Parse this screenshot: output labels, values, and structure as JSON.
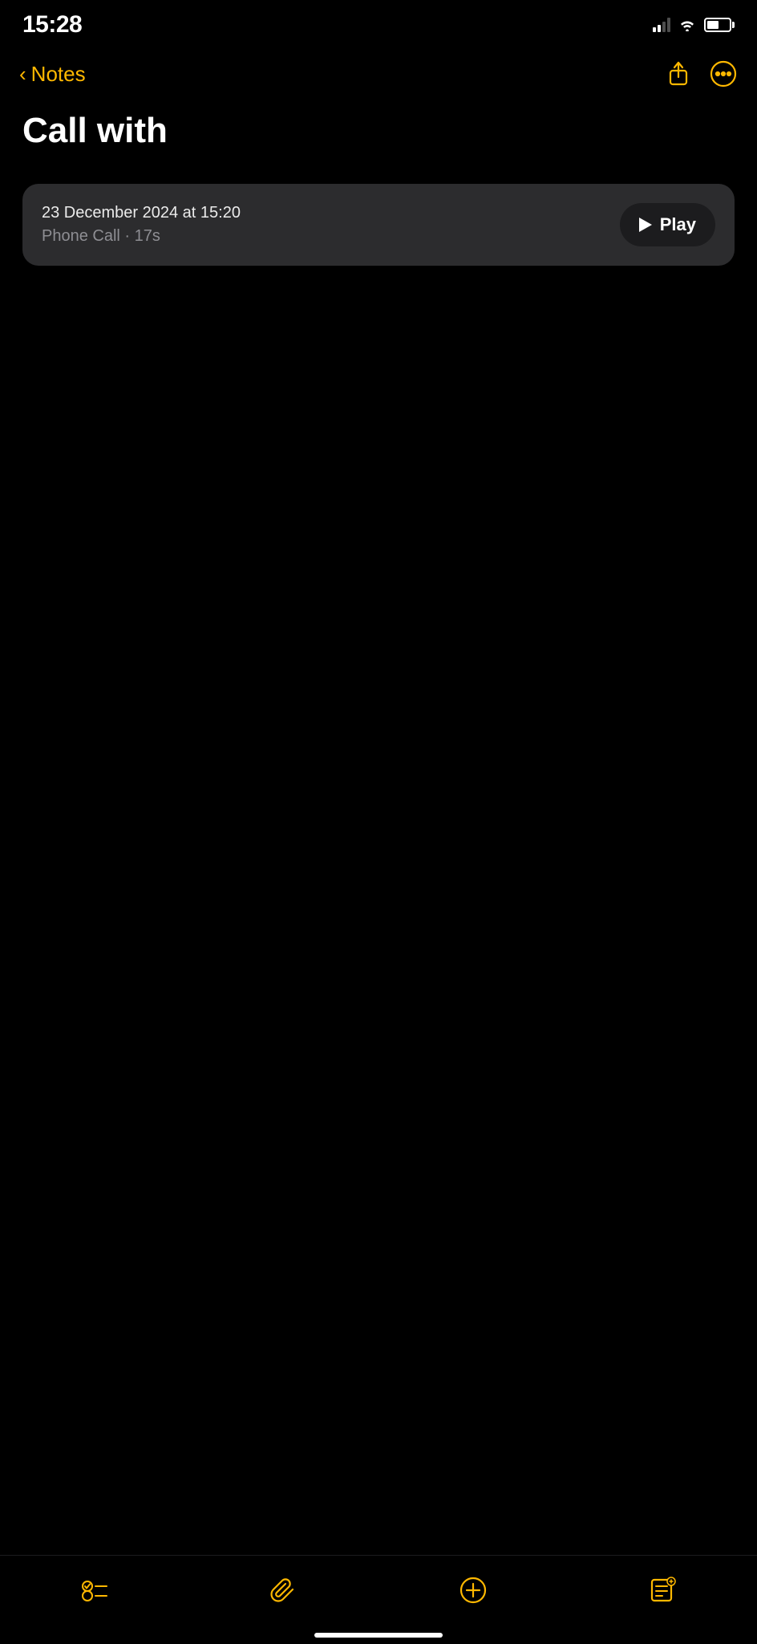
{
  "statusBar": {
    "time": "15:28",
    "signalBars": 2,
    "battery": 55
  },
  "navBar": {
    "backLabel": "Notes",
    "shareIconName": "share-icon",
    "moreIconName": "more-icon"
  },
  "note": {
    "title": "Call with",
    "recording": {
      "date": "23 December 2024 at 15:20",
      "meta": "Phone Call · 17s",
      "playLabel": "Play"
    }
  },
  "toolbar": {
    "checklistIconName": "checklist-icon",
    "attachIconName": "attach-icon",
    "composeIconName": "compose-icon",
    "editIconName": "edit-icon"
  }
}
